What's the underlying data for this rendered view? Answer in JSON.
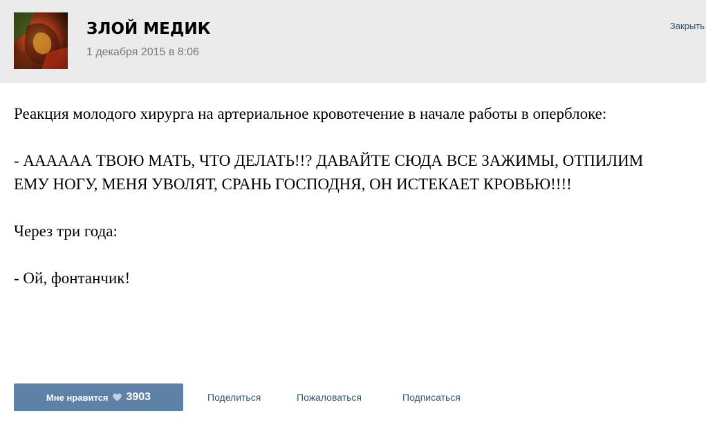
{
  "header": {
    "author_name": "ЗЛОЙ МЕДИК",
    "date": "1 декабря 2015 в 8:06",
    "close_label": "Закрыть"
  },
  "post": {
    "paragraphs": [
      "Реакция молодого хирурга на артериальное кровотечение в начале работы в оперблоке:",
      "- АААААА ТВОЮ МАТЬ, ЧТО ДЕЛАТЬ!!? ДАВАЙТЕ СЮДА ВСЕ ЗАЖИМЫ, ОТПИЛИМ ЕМУ НОГУ, МЕНЯ УВОЛЯТ, СРАНЬ ГОСПОДНЯ, ОН ИСТЕКАЕТ КРОВЬЮ!!!!",
      "Через три года:",
      "- Ой, фонтанчик!"
    ]
  },
  "actions": {
    "like_label": "Мне нравится",
    "like_count": "3903",
    "share_label": "Поделиться",
    "report_label": "Пожаловаться",
    "subscribe_label": "Подписаться"
  },
  "icons": {
    "like": "heart-icon"
  },
  "colors": {
    "header_bg": "#ebebeb",
    "link": "#2b587a",
    "like_button_bg": "#5e81a8",
    "date_text": "#777777"
  }
}
